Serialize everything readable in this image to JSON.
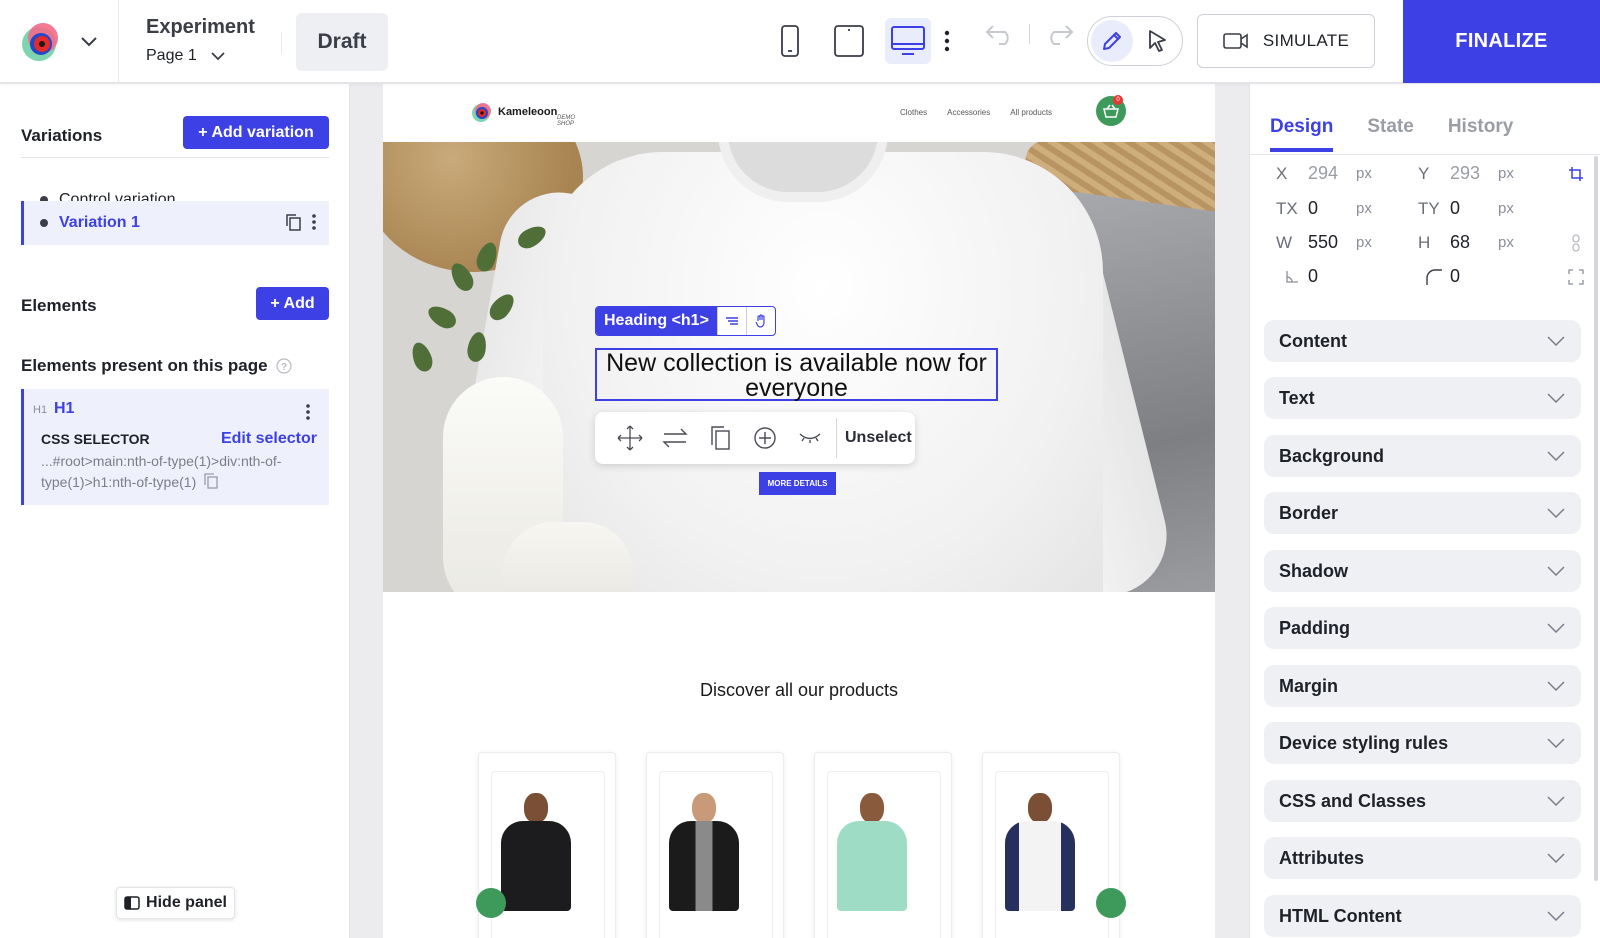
{
  "topbar": {
    "experiment_label": "Experiment",
    "page_label": "Page 1",
    "draft_label": "Draft",
    "simulate_label": "SIMULATE",
    "finalize_label": "FINALIZE",
    "active_device": "desktop",
    "active_mode": "edit"
  },
  "left": {
    "variations_title": "Variations",
    "add_variation_label": "+ Add variation",
    "variations": [
      {
        "label": "Control variation",
        "selected": false
      },
      {
        "label": "Variation 1",
        "selected": true
      }
    ],
    "elements_title": "Elements",
    "add_label": "+ Add",
    "present_title": "Elements present on this page",
    "element": {
      "tag": "H1",
      "name": "H1",
      "css_selector_label": "CSS SELECTOR",
      "edit_selector_label": "Edit selector",
      "selector": "...#root>main:nth-of-type(1)>div:nth-of-type(1)>h1:nth-of-type(1)"
    },
    "hide_panel_label": "Hide panel"
  },
  "site": {
    "brand": "Kameleoon",
    "brand_sub": "DEMO SHOP",
    "menu": [
      "Clothes",
      "Accessories",
      "All products"
    ],
    "cart_count": "0",
    "heading_tag_label": "Heading <h1>",
    "heading_text": "New collection is available now for everyone",
    "unselect_label": "Unselect",
    "more_details_label": "MORE DETAILS",
    "discover_title": "Discover all our products"
  },
  "right": {
    "tabs": [
      "Design",
      "State",
      "History"
    ],
    "active_tab": "Design",
    "props": {
      "x_label": "X",
      "x_value": "294",
      "x_unit": "px",
      "y_label": "Y",
      "y_value": "293",
      "y_unit": "px",
      "tx_label": "TX",
      "tx_value": "0",
      "tx_unit": "px",
      "ty_label": "TY",
      "ty_value": "0",
      "ty_unit": "px",
      "w_label": "W",
      "w_value": "550",
      "w_unit": "px",
      "h_label": "H",
      "h_value": "68",
      "h_unit": "px",
      "angle_value": "0",
      "radius_value": "0"
    },
    "sections": [
      "Content",
      "Text",
      "Background",
      "Border",
      "Shadow",
      "Padding",
      "Margin",
      "Device styling rules",
      "CSS and Classes",
      "Attributes",
      "HTML Content"
    ]
  },
  "colors": {
    "accent": "#3d41e5",
    "green": "#3d9a5a"
  }
}
